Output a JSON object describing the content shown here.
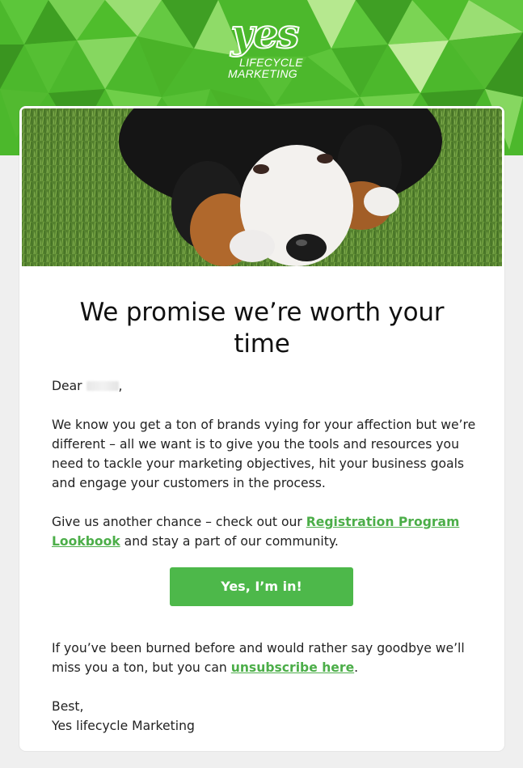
{
  "brand": {
    "logo_mark": "yes",
    "logo_line1": "LIFECYCLE",
    "logo_line2": "MARKETING",
    "accent_color": "#4cb82c",
    "link_color": "#4cae49",
    "button_color": "#4db84a"
  },
  "hero": {
    "image": "bernese-mountain-dog-puppy-on-grass"
  },
  "email": {
    "headline": "We promise we’re worth your time",
    "greeting_prefix": "Dear",
    "greeting_suffix": ",",
    "paragraph1": "We know you get a ton of brands vying for your affection but we’re different – all we want is to give you the tools and resources you need to tackle your marketing objectives, hit your business goals and engage your customers in the process.",
    "paragraph2_prefix": "Give us another chance – check out our ",
    "paragraph2_link": "Registration Program Lookbook",
    "paragraph2_suffix": " and stay a part of our community.",
    "cta_label": "Yes, I’m in!",
    "paragraph3_prefix": "If you’ve been burned before and would rather say goodbye we’ll miss you a ton, but you can ",
    "paragraph3_link": "unsubscribe here",
    "paragraph3_suffix": ".",
    "signoff_line1": "Best,",
    "signoff_line2": "Yes lifecycle Marketing"
  }
}
